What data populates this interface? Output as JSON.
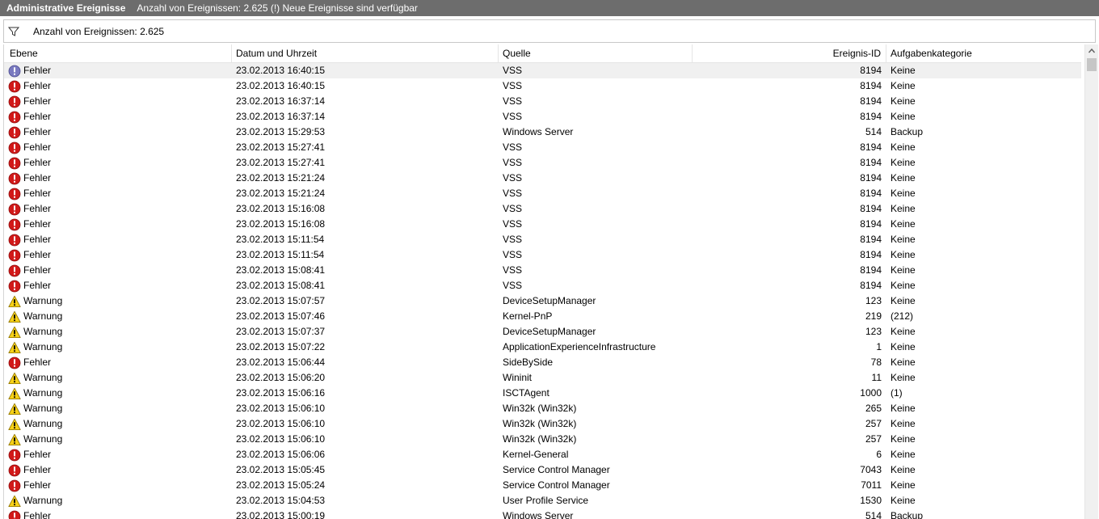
{
  "title": {
    "name": "Administrative Ereignisse",
    "info": "Anzahl von Ereignissen: 2.625 (!) Neue Ereignisse sind verfügbar"
  },
  "filter": {
    "icon": "filter-icon",
    "text": "Anzahl von Ereignissen: 2.625"
  },
  "columns": {
    "level": "Ebene",
    "datetime": "Datum und Uhrzeit",
    "source": "Quelle",
    "event_id": "Ereignis-ID",
    "category": "Aufgabenkategorie"
  },
  "colors": {
    "titlebar": "#6d6d6d",
    "error": "#d11919",
    "warning": "#f6d017",
    "selected_row": "#f0f0f0"
  },
  "rows": [
    {
      "type": "error",
      "level": "Fehler",
      "datetime": "23.02.2013 16:40:15",
      "source": "VSS",
      "id": "8194",
      "category": "Keine",
      "selected": true
    },
    {
      "type": "error",
      "level": "Fehler",
      "datetime": "23.02.2013 16:40:15",
      "source": "VSS",
      "id": "8194",
      "category": "Keine"
    },
    {
      "type": "error",
      "level": "Fehler",
      "datetime": "23.02.2013 16:37:14",
      "source": "VSS",
      "id": "8194",
      "category": "Keine"
    },
    {
      "type": "error",
      "level": "Fehler",
      "datetime": "23.02.2013 16:37:14",
      "source": "VSS",
      "id": "8194",
      "category": "Keine"
    },
    {
      "type": "error",
      "level": "Fehler",
      "datetime": "23.02.2013 15:29:53",
      "source": "Windows Server",
      "id": "514",
      "category": "Backup"
    },
    {
      "type": "error",
      "level": "Fehler",
      "datetime": "23.02.2013 15:27:41",
      "source": "VSS",
      "id": "8194",
      "category": "Keine"
    },
    {
      "type": "error",
      "level": "Fehler",
      "datetime": "23.02.2013 15:27:41",
      "source": "VSS",
      "id": "8194",
      "category": "Keine"
    },
    {
      "type": "error",
      "level": "Fehler",
      "datetime": "23.02.2013 15:21:24",
      "source": "VSS",
      "id": "8194",
      "category": "Keine"
    },
    {
      "type": "error",
      "level": "Fehler",
      "datetime": "23.02.2013 15:21:24",
      "source": "VSS",
      "id": "8194",
      "category": "Keine"
    },
    {
      "type": "error",
      "level": "Fehler",
      "datetime": "23.02.2013 15:16:08",
      "source": "VSS",
      "id": "8194",
      "category": "Keine"
    },
    {
      "type": "error",
      "level": "Fehler",
      "datetime": "23.02.2013 15:16:08",
      "source": "VSS",
      "id": "8194",
      "category": "Keine"
    },
    {
      "type": "error",
      "level": "Fehler",
      "datetime": "23.02.2013 15:11:54",
      "source": "VSS",
      "id": "8194",
      "category": "Keine"
    },
    {
      "type": "error",
      "level": "Fehler",
      "datetime": "23.02.2013 15:11:54",
      "source": "VSS",
      "id": "8194",
      "category": "Keine"
    },
    {
      "type": "error",
      "level": "Fehler",
      "datetime": "23.02.2013 15:08:41",
      "source": "VSS",
      "id": "8194",
      "category": "Keine"
    },
    {
      "type": "error",
      "level": "Fehler",
      "datetime": "23.02.2013 15:08:41",
      "source": "VSS",
      "id": "8194",
      "category": "Keine"
    },
    {
      "type": "warning",
      "level": "Warnung",
      "datetime": "23.02.2013 15:07:57",
      "source": "DeviceSetupManager",
      "id": "123",
      "category": "Keine"
    },
    {
      "type": "warning",
      "level": "Warnung",
      "datetime": "23.02.2013 15:07:46",
      "source": "Kernel-PnP",
      "id": "219",
      "category": "(212)"
    },
    {
      "type": "warning",
      "level": "Warnung",
      "datetime": "23.02.2013 15:07:37",
      "source": "DeviceSetupManager",
      "id": "123",
      "category": "Keine"
    },
    {
      "type": "warning",
      "level": "Warnung",
      "datetime": "23.02.2013 15:07:22",
      "source": "ApplicationExperienceInfrastructure",
      "id": "1",
      "category": "Keine"
    },
    {
      "type": "error",
      "level": "Fehler",
      "datetime": "23.02.2013 15:06:44",
      "source": "SideBySide",
      "id": "78",
      "category": "Keine"
    },
    {
      "type": "warning",
      "level": "Warnung",
      "datetime": "23.02.2013 15:06:20",
      "source": "Wininit",
      "id": "11",
      "category": "Keine"
    },
    {
      "type": "warning",
      "level": "Warnung",
      "datetime": "23.02.2013 15:06:16",
      "source": "ISCTAgent",
      "id": "1000",
      "category": "(1)"
    },
    {
      "type": "warning",
      "level": "Warnung",
      "datetime": "23.02.2013 15:06:10",
      "source": "Win32k (Win32k)",
      "id": "265",
      "category": "Keine"
    },
    {
      "type": "warning",
      "level": "Warnung",
      "datetime": "23.02.2013 15:06:10",
      "source": "Win32k (Win32k)",
      "id": "257",
      "category": "Keine"
    },
    {
      "type": "warning",
      "level": "Warnung",
      "datetime": "23.02.2013 15:06:10",
      "source": "Win32k (Win32k)",
      "id": "257",
      "category": "Keine"
    },
    {
      "type": "error",
      "level": "Fehler",
      "datetime": "23.02.2013 15:06:06",
      "source": "Kernel-General",
      "id": "6",
      "category": "Keine"
    },
    {
      "type": "error",
      "level": "Fehler",
      "datetime": "23.02.2013 15:05:45",
      "source": "Service Control Manager",
      "id": "7043",
      "category": "Keine"
    },
    {
      "type": "error",
      "level": "Fehler",
      "datetime": "23.02.2013 15:05:24",
      "source": "Service Control Manager",
      "id": "7011",
      "category": "Keine"
    },
    {
      "type": "warning",
      "level": "Warnung",
      "datetime": "23.02.2013 15:04:53",
      "source": "User Profile Service",
      "id": "1530",
      "category": "Keine"
    },
    {
      "type": "error",
      "level": "Fehler",
      "datetime": "23.02.2013 15:00:19",
      "source": "Windows Server",
      "id": "514",
      "category": "Backup"
    }
  ]
}
